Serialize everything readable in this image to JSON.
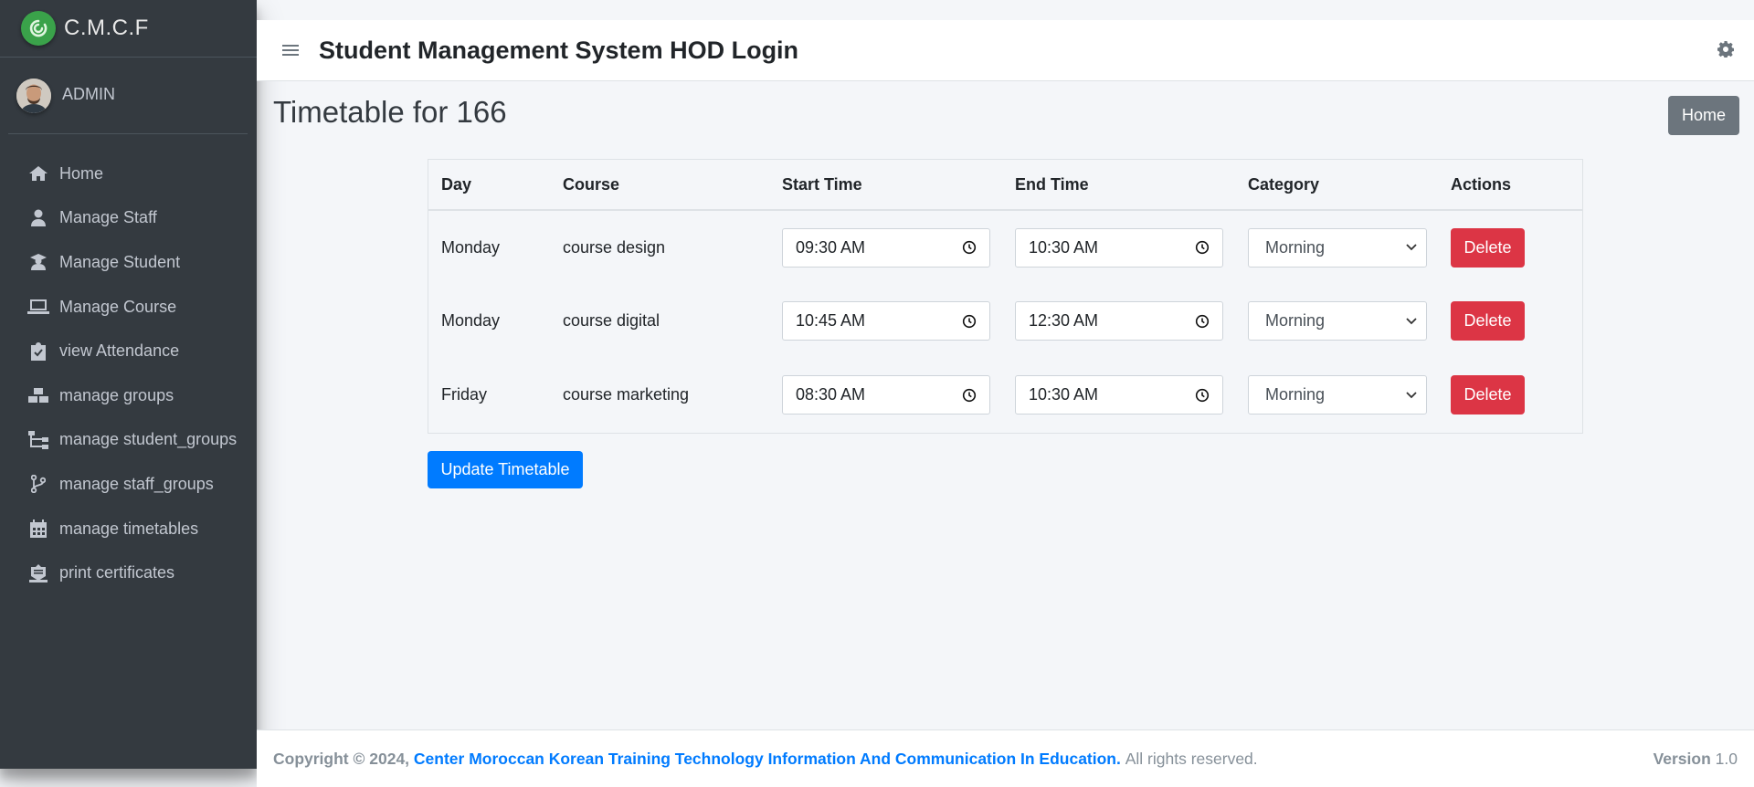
{
  "brand": {
    "name": "C.M.C.F"
  },
  "user": {
    "name": "ADMIN"
  },
  "sidebar": {
    "items": [
      {
        "label": "Home",
        "icon": "home-icon"
      },
      {
        "label": "Manage Staff",
        "icon": "user-icon"
      },
      {
        "label": "Manage Student",
        "icon": "graduate-icon"
      },
      {
        "label": "Manage Course",
        "icon": "laptop-icon"
      },
      {
        "label": "view Attendance",
        "icon": "clipboard-check-icon"
      },
      {
        "label": "manage groups",
        "icon": "cubes-icon"
      },
      {
        "label": "manage student_groups",
        "icon": "sitemap-icon"
      },
      {
        "label": "manage staff_groups",
        "icon": "code-branch-icon"
      },
      {
        "label": "manage timetables",
        "icon": "calendar-icon"
      },
      {
        "label": "print certificates",
        "icon": "certificate-icon"
      }
    ]
  },
  "header": {
    "title": "Student Management System HOD Login"
  },
  "page": {
    "title": "Timetable for 166",
    "home_button": "Home"
  },
  "table": {
    "headers": [
      "Day",
      "Course",
      "Start Time",
      "End Time",
      "Category",
      "Actions"
    ],
    "rows": [
      {
        "day": "Monday",
        "course": "course design",
        "start": "09:30  AM",
        "end": "10:30  AM",
        "category": "Morning",
        "action": "Delete"
      },
      {
        "day": "Monday",
        "course": "course digital",
        "start": "10:45  AM",
        "end": "12:30  AM",
        "category": "Morning",
        "action": "Delete"
      },
      {
        "day": "Friday",
        "course": "course marketing",
        "start": "08:30  AM",
        "end": "10:30  AM",
        "category": "Morning",
        "action": "Delete"
      }
    ]
  },
  "update_button": "Update Timetable",
  "footer": {
    "copyright": "Copyright © 2024,",
    "org": "Center Moroccan Korean Training Technology Information And Communication In Education.",
    "rights": "All rights reserved.",
    "version_label": "Version",
    "version_value": "1.0"
  },
  "colors": {
    "sidebar": "#343a40",
    "primary": "#007bff",
    "danger": "#dc3545",
    "secondary": "#6c757d",
    "brand_logo": "#3aa24a"
  }
}
